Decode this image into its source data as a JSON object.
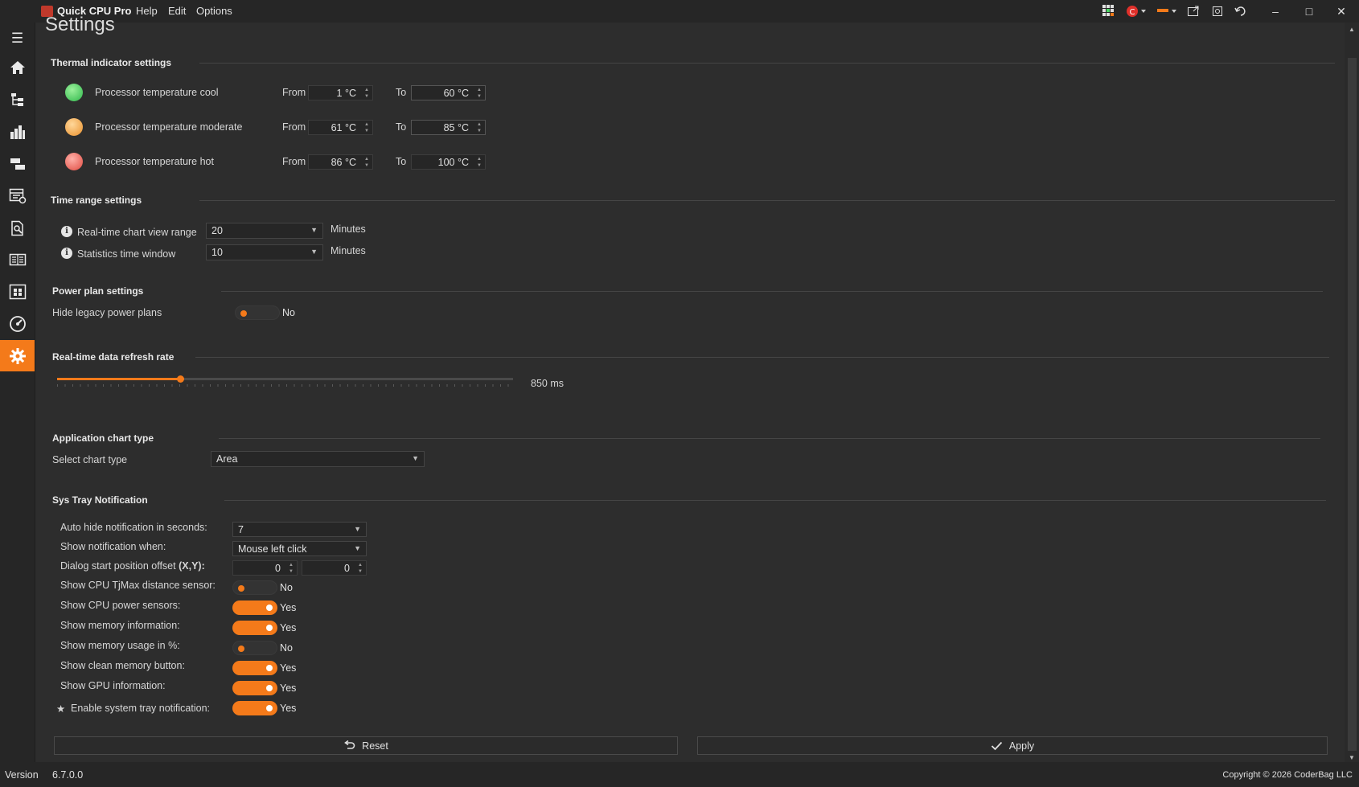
{
  "titlebar": {
    "app_title": "Quick CPU Pro",
    "menus": [
      "Help",
      "Edit",
      "Options"
    ],
    "icons": [
      "grid-icon",
      "badge-icon",
      "theme-icon",
      "popout-icon",
      "snapshot-icon",
      "undo-icon"
    ]
  },
  "sidebar": {
    "items": [
      "home",
      "tree",
      "bar-chart",
      "hierarchy",
      "table-settings",
      "report",
      "book",
      "circuit",
      "speedometer",
      "settings"
    ],
    "active": "settings"
  },
  "page": {
    "title": "Settings"
  },
  "thermal": {
    "title": "Thermal indicator settings",
    "from_label": "From",
    "to_label": "To",
    "rows": [
      {
        "label": "Processor temperature cool",
        "color": "#4cd964",
        "from": "1 °C",
        "to": "60 °C"
      },
      {
        "label": "Processor temperature moderate",
        "color": "#f2a040",
        "from": "61 °C",
        "to": "85 °C"
      },
      {
        "label": "Processor temperature hot",
        "color": "#ee5a4f",
        "from": "86 °C",
        "to": "100 °C"
      }
    ]
  },
  "time_range": {
    "title": "Time range settings",
    "view_range_label": "Real-time chart view range",
    "view_range_value": "20",
    "stats_window_label": "Statistics time window",
    "stats_window_value": "10",
    "unit": "Minutes"
  },
  "power_plan": {
    "title": "Power plan settings",
    "hide_legacy_label": "Hide legacy power plans",
    "hide_legacy_value": "No"
  },
  "refresh_rate": {
    "title": "Real-time data refresh rate",
    "value_label": "850 ms",
    "fraction": 0.27
  },
  "chart_type": {
    "title": "Application chart type",
    "label": "Select chart type",
    "value": "Area"
  },
  "tray": {
    "title": "Sys Tray Notification",
    "auto_hide_label": "Auto hide notification in seconds:",
    "auto_hide_value": "7",
    "show_when_label": "Show notification when:",
    "show_when_value": "Mouse left click",
    "offset_label": "Dialog start position offset",
    "offset_suffix": "(X,Y):",
    "offset_x": "0",
    "offset_y": "0",
    "toggles": [
      {
        "label": "Show CPU TjMax distance sensor:",
        "value": "No"
      },
      {
        "label": "Show CPU power sensors:",
        "value": "Yes"
      },
      {
        "label": "Show memory information:",
        "value": "Yes"
      },
      {
        "label": "Show memory usage in %:",
        "value": "No"
      },
      {
        "label": "Show clean memory button:",
        "value": "Yes"
      },
      {
        "label": "Show GPU information:",
        "value": "Yes"
      },
      {
        "label": "Enable system tray notification:",
        "value": "Yes"
      }
    ]
  },
  "buttons": {
    "reset": "Reset",
    "apply": "Apply"
  },
  "status": {
    "version_label": "Version",
    "version_value": "6.7.0.0",
    "copyright": "Copyright © 2026 CoderBag LLC"
  },
  "colors": {
    "accent": "#f47a1a",
    "background": "#2d2d2d"
  }
}
